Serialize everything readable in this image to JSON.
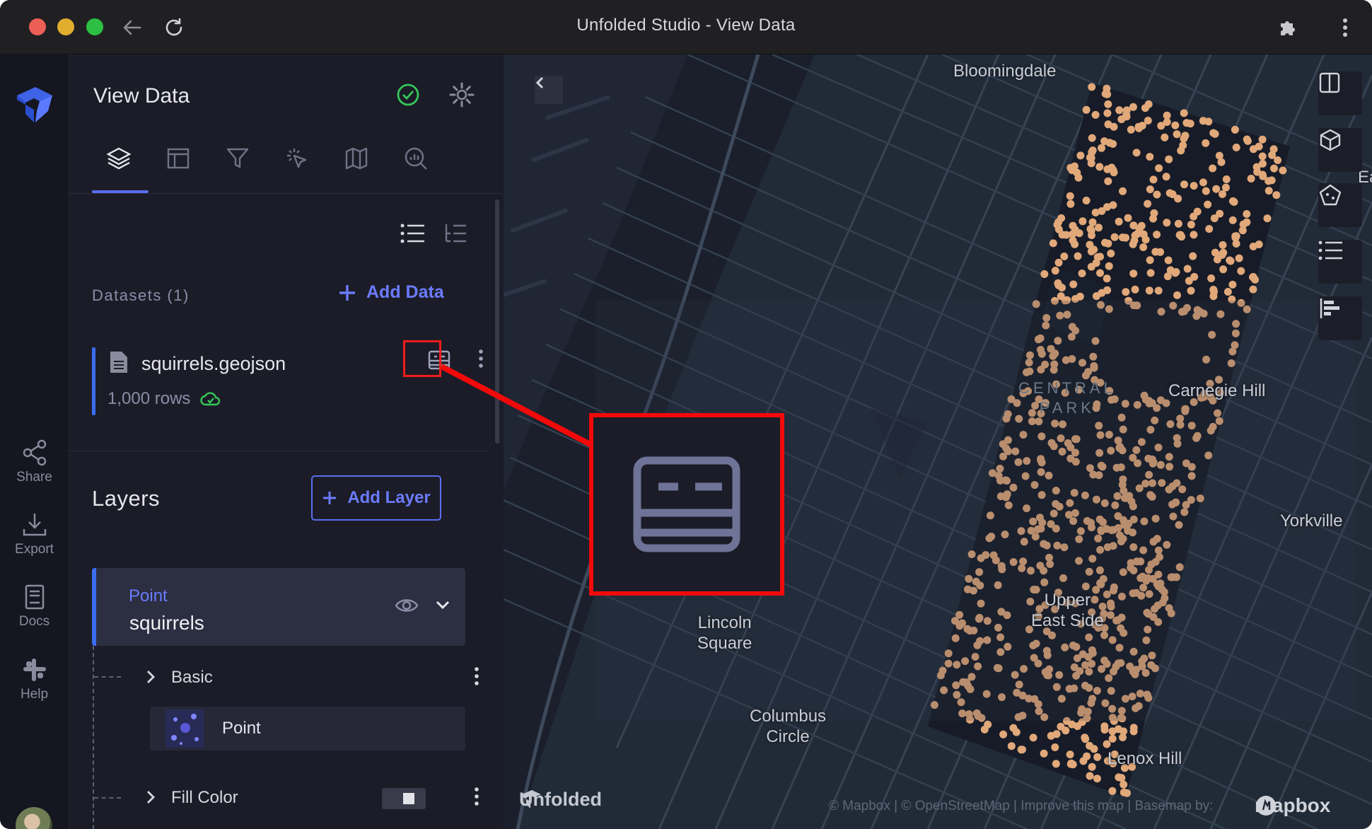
{
  "window": {
    "title": "Unfolded Studio - View Data"
  },
  "rail": {
    "items": [
      {
        "label": "Share"
      },
      {
        "label": "Export"
      },
      {
        "label": "Docs"
      },
      {
        "label": "Help"
      }
    ]
  },
  "panel": {
    "title": "View Data",
    "datasets": {
      "label": "Datasets (1)",
      "add_label": "Add Data",
      "items": [
        {
          "name": "squirrels.geojson",
          "rows": "1,000 rows"
        }
      ]
    },
    "layers": {
      "title": "Layers",
      "add_label": "Add Layer",
      "items": [
        {
          "type": "Point",
          "name": "squirrels"
        }
      ]
    },
    "properties": {
      "basic_label": "Basic",
      "point_label": "Point",
      "fill_color_label": "Fill Color"
    }
  },
  "map": {
    "labels": {
      "bloomingdale": "Bloomingdale",
      "carnegie_hill": "Carnegie Hill",
      "yorkville": "Yorkville",
      "upper_east_side": "Upper\nEast Side",
      "lincoln_square": "Lincoln\nSquare",
      "columbus_circle": "Columbus\nCircle",
      "lenox_hill": "Lenox Hill",
      "central_park": "CENTRAL\nPARK",
      "edge": "Ea"
    },
    "attribution": "© Mapbox | © OpenStreetMap | Improve this map | Basemap by:",
    "mapbox_label": "mapbox",
    "unfolded_label": "Unfolded",
    "point_color": "#e1a87a"
  }
}
